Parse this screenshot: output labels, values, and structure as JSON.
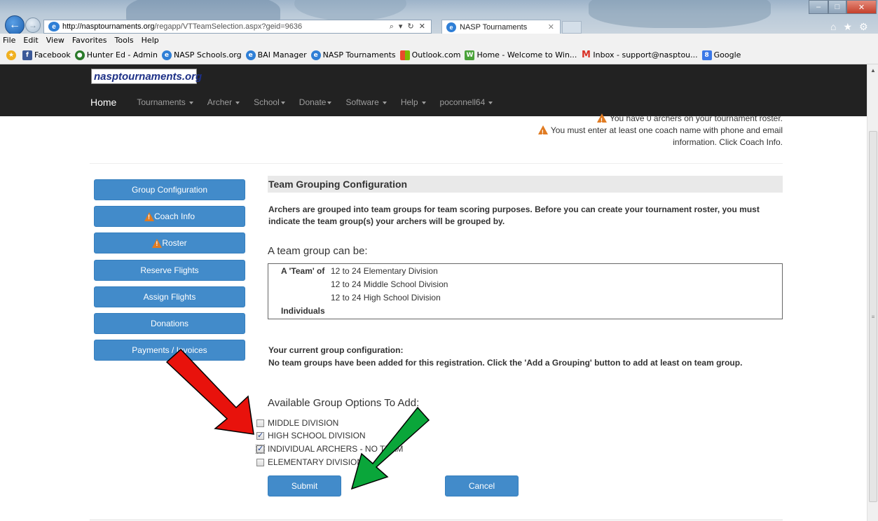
{
  "browser": {
    "url_host": "http://nasptournaments.org",
    "url_path": "/regapp/VTTeamSelection.aspx?geid=9636",
    "address_tools": "⌕ ▾ ↻ ✕",
    "tab_title": "NASP Tournaments",
    "menu": [
      "File",
      "Edit",
      "View",
      "Favorites",
      "Tools",
      "Help"
    ],
    "favorites": [
      {
        "label": "Facebook",
        "icon": "facebook-icon",
        "color": "#3b5998"
      },
      {
        "label": "Hunter Ed - Admin",
        "icon": "globe-icon",
        "color": "#2a7a2a"
      },
      {
        "label": "NASP Schools.org",
        "icon": "ie-page-icon",
        "color": "#2f7fd6"
      },
      {
        "label": "BAI Manager",
        "icon": "ie-page-icon",
        "color": "#2f7fd6"
      },
      {
        "label": "NASP Tournaments",
        "icon": "ie-page-icon",
        "color": "#2f7fd6"
      },
      {
        "label": "Outlook.com",
        "icon": "windows-icon",
        "color": "#e94b2b"
      },
      {
        "label": "Home - Welcome to Win...",
        "icon": "sharepoint-icon",
        "color": "#4aa23a"
      },
      {
        "label": "Inbox - support@nasptou...",
        "icon": "gmail-icon",
        "color": "#d93025"
      },
      {
        "label": "Google",
        "icon": "google-icon",
        "color": "#3b78e7"
      }
    ]
  },
  "site": {
    "brand": "nasptournaments.org",
    "nav": {
      "home": "Home",
      "items": [
        "Tournaments",
        "Archer",
        "School",
        "Donate",
        "Software",
        "Help",
        "poconnell64"
      ]
    },
    "warnings": {
      "roster": "You have 0 archers on your tournament roster.",
      "coach_line1": "You must enter at least one coach name with phone and email",
      "coach_line2": "information. Click Coach Info."
    }
  },
  "sidebar": {
    "buttons": [
      {
        "label": "Group Configuration",
        "warn": false
      },
      {
        "label": "Coach Info",
        "warn": true
      },
      {
        "label": "Roster",
        "warn": true
      },
      {
        "label": "Reserve Flights",
        "warn": false
      },
      {
        "label": "Assign Flights",
        "warn": false
      },
      {
        "label": "Donations",
        "warn": false
      },
      {
        "label": "Payments / Invoices",
        "warn": false
      }
    ]
  },
  "main": {
    "heading": "Team Grouping Configuration",
    "intro": "Archers are grouped into team groups for team scoring purposes. Before you can create your tournament roster, you must indicate the team group(s) your archers will be grouped by.",
    "can_be_label": "A team group can be:",
    "group_box": {
      "team_prefix": "A 'Team' of",
      "team_options": [
        "12 to 24 Elementary Division",
        "12 to 24 Middle School Division",
        "12 to 24 High School Division"
      ],
      "individuals": "Individuals"
    },
    "current_label": "Your current group configuration:",
    "current_value": "No team groups have been added for this registration. Click the 'Add a Grouping' button to add at least on team group.",
    "available_label": "Available Group Options To Add:",
    "options": [
      {
        "label": "MIDDLE DIVISION",
        "checked": false
      },
      {
        "label": "HIGH SCHOOL DIVISION",
        "checked": true
      },
      {
        "label": "INDIVIDUAL ARCHERS - NO TEAM",
        "checked": true
      },
      {
        "label": "ELEMENTARY DIVISION",
        "checked": false
      }
    ],
    "submit_label": "Submit",
    "cancel_label": "Cancel"
  },
  "annotations": {
    "red_arrow_color": "#e8120c",
    "green_arrow_color": "#0aa63a"
  }
}
